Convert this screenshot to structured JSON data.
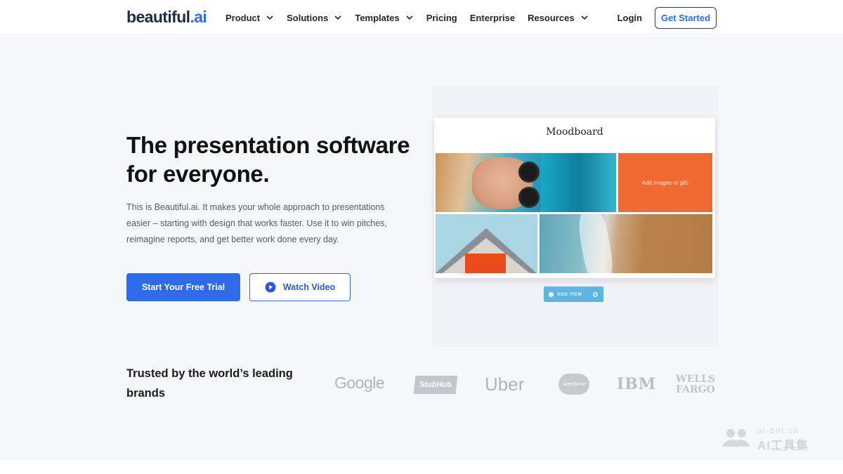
{
  "brand": {
    "logo_main": "beautiful",
    "logo_suffix": ".ai",
    "accent": "#2d6bea"
  },
  "nav": {
    "items": [
      {
        "label": "Product",
        "has_dropdown": true
      },
      {
        "label": "Solutions",
        "has_dropdown": true
      },
      {
        "label": "Templates",
        "has_dropdown": true
      },
      {
        "label": "Pricing",
        "has_dropdown": false
      },
      {
        "label": "Enterprise",
        "has_dropdown": false
      },
      {
        "label": "Resources",
        "has_dropdown": true
      }
    ],
    "login": "Login",
    "get_started": "Get Started"
  },
  "hero": {
    "title": "The presentation software for everyone.",
    "description": "This is Beautiful.ai. It makes your whole approach to presentations easier – starting with design that works faster. Use it to win pitches, reimagine reports, and get better work done every day.",
    "cta_primary": "Start Your Free Trial",
    "cta_secondary": "Watch Video",
    "cta_secondary_icon": "play-circle-icon"
  },
  "mockup": {
    "slide_title": "Moodboard",
    "placeholder_tile": "Add images or gifs",
    "add_item": "ADD ITEM",
    "add_item_icon": "plus-icon",
    "settings_icon": "gear-icon",
    "placeholder_color": "#ef6a32"
  },
  "trusted": {
    "heading": "Trusted by the world’s leading brands",
    "brands": [
      "Google",
      "StubHub",
      "Uber",
      "salesforce",
      "IBM",
      "WELLS FARGO"
    ]
  },
  "watermark": {
    "url": "ai-bot.cn",
    "text": "AI工具集"
  }
}
